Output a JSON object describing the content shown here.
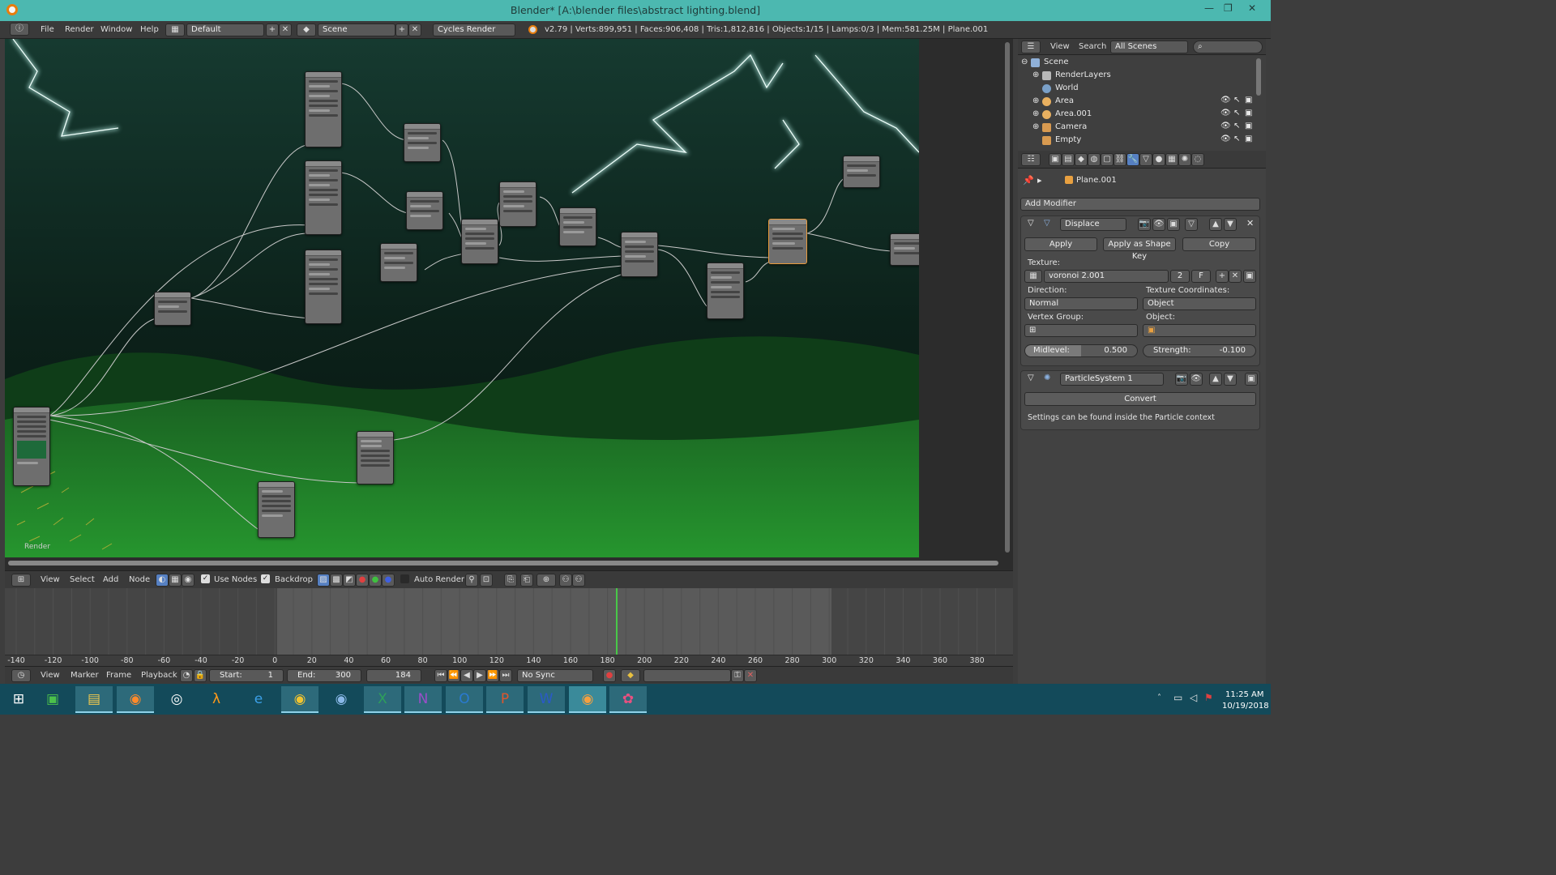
{
  "window": {
    "title": "Blender* [A:\\blender files\\abstract lighting.blend]",
    "minimize": "—",
    "maximize": "❐",
    "close": "✕"
  },
  "menubar": {
    "menus": [
      "File",
      "Render",
      "Window",
      "Help"
    ],
    "layout": "Default",
    "scene": "Scene",
    "engine": "Cycles Render",
    "stats": "v2.79 | Verts:899,951 | Faces:906,408 | Tris:1,812,816 | Objects:1/15 | Lamps:0/3 | Mem:581.25M | Plane.001"
  },
  "node_editor": {
    "backdrop_label": "Render",
    "menus": [
      "View",
      "Select",
      "Add",
      "Node"
    ],
    "use_nodes_label": "Use Nodes",
    "backdrop_check_label": "Backdrop",
    "auto_render_label": "Auto Render"
  },
  "timeline": {
    "ticks": [
      "-140",
      "-120",
      "-100",
      "-80",
      "-60",
      "-40",
      "-20",
      "0",
      "20",
      "40",
      "60",
      "80",
      "100",
      "120",
      "140",
      "160",
      "180",
      "200",
      "220",
      "240",
      "260",
      "280",
      "300",
      "320",
      "340",
      "360",
      "380"
    ],
    "menus": [
      "View",
      "Marker",
      "Frame",
      "Playback"
    ],
    "start_label": "Start:",
    "start": "1",
    "end_label": "End:",
    "end": "300",
    "current": "184",
    "sync": "No Sync"
  },
  "outliner": {
    "menus": [
      "View",
      "Search"
    ],
    "filter": "All Scenes",
    "items": [
      {
        "label": "Scene",
        "icon": "scene-icon",
        "color": "#8fb0d8"
      },
      {
        "label": "RenderLayers",
        "icon": "renderlayers-icon",
        "color": "#b8b8b8"
      },
      {
        "label": "World",
        "icon": "world-icon",
        "color": "#7aa0c8"
      },
      {
        "label": "Area",
        "icon": "lamp-icon",
        "color": "#e8b060"
      },
      {
        "label": "Area.001",
        "icon": "lamp-icon",
        "color": "#e8b060"
      },
      {
        "label": "Camera",
        "icon": "camera-icon",
        "color": "#d89a50"
      },
      {
        "label": "Empty",
        "icon": "empty-icon",
        "color": "#d89a50"
      }
    ]
  },
  "properties": {
    "object_name": "Plane.001",
    "add_modifier": "Add Modifier",
    "displace": {
      "name": "Displace",
      "apply": "Apply",
      "apply_shape": "Apply as Shape Key",
      "copy": "Copy",
      "texture_label": "Texture:",
      "texture": "voronoi 2.001",
      "texture_users": "2",
      "texture_fake": "F",
      "direction_label": "Direction:",
      "direction": "Normal",
      "coords_label": "Texture Coordinates:",
      "coords": "Object",
      "vgroup_label": "Vertex Group:",
      "object_label": "Object:",
      "midlevel_label": "Midlevel:",
      "midlevel": "0.500",
      "strength_label": "Strength:",
      "strength": "-0.100"
    },
    "particles": {
      "name": "ParticleSystem 1",
      "convert": "Convert",
      "note": "Settings can be found inside the Particle context"
    }
  },
  "taskbar": {
    "time": "11:25 AM",
    "date": "10/19/2018",
    "apps": [
      "start",
      "store",
      "explorer",
      "firefox",
      "steam",
      "half-life",
      "edge",
      "chrome",
      "chrome-alt",
      "excel",
      "onenote",
      "outlook",
      "powerpoint",
      "word",
      "blender",
      "paint"
    ]
  },
  "colors": {
    "titlebar": "#4cb8b0",
    "taskbar": "#134a5a",
    "lightning": "#c8fff8",
    "grass": "#1f8a2a",
    "timeline_marker": "#48c848"
  }
}
